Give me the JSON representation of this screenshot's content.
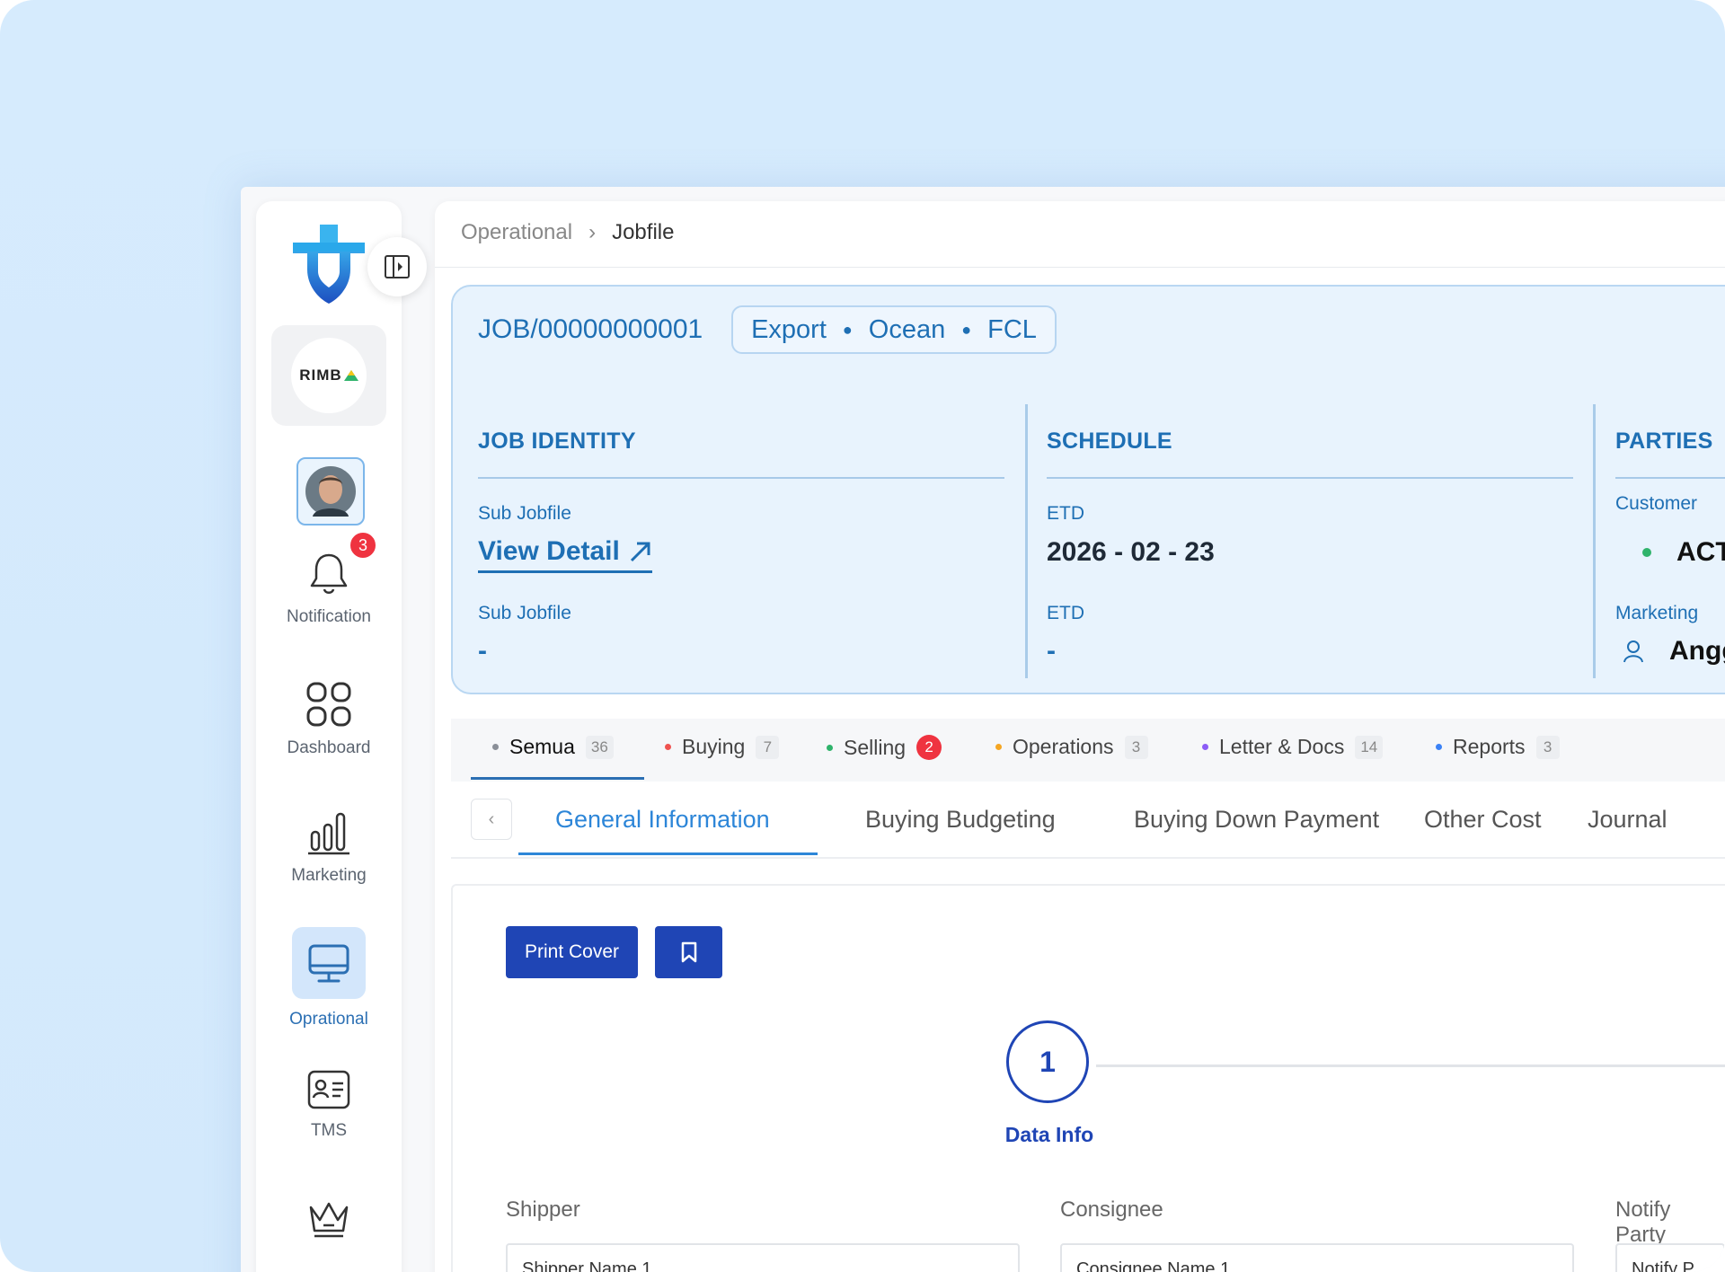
{
  "breadcrumb": {
    "parent": "Operational",
    "separator": "›",
    "current": "Jobfile"
  },
  "company": {
    "logo_text": "RIMB"
  },
  "sidebar": {
    "notification": {
      "label": "Notification",
      "badge": "3"
    },
    "items": [
      {
        "label": "Dashboard",
        "icon": "grid-icon"
      },
      {
        "label": "Marketing",
        "icon": "bar-chart-icon"
      },
      {
        "label": "Oprational",
        "icon": "monitor-icon",
        "active": true
      },
      {
        "label": "TMS",
        "icon": "id-card-icon"
      },
      {
        "label": "",
        "icon": "crown-icon"
      }
    ]
  },
  "job": {
    "id": "JOB/00000000001",
    "tags": [
      "Export",
      "Ocean",
      "FCL"
    ],
    "identity": {
      "title": "JOB IDENTITY",
      "sub1_label": "Sub Jobfile",
      "view_detail": "View Detail",
      "sub2_label": "Sub Jobfile",
      "sub2_value": "-"
    },
    "schedule": {
      "title": "SCHEDULE",
      "etd1_label": "ETD",
      "etd1_value": "2026 - 02 - 23",
      "etd2_label": "ETD",
      "etd2_value": "-"
    },
    "parties": {
      "title": "PARTIES",
      "customer_label": "Customer",
      "customer_value": "ACT",
      "marketing_label": "Marketing",
      "marketing_value": "Angg"
    }
  },
  "filter_tabs": [
    {
      "label": "Semua",
      "count": "36",
      "color": "#8a8f98",
      "active": true
    },
    {
      "label": "Buying",
      "count": "7",
      "color": "#ef5350"
    },
    {
      "label": "Selling",
      "count": "2",
      "color": "#2fb36b",
      "alert": true
    },
    {
      "label": "Operations",
      "count": "3",
      "color": "#f5a623"
    },
    {
      "label": "Letter & Docs",
      "count": "14",
      "color": "#8b5cf6"
    },
    {
      "label": "Reports",
      "count": "3",
      "color": "#3b82f6"
    }
  ],
  "sub_tabs": [
    "General Information",
    "Buying Budgeting",
    "Buying Down Payment",
    "Other Cost",
    "Journal"
  ],
  "actions": {
    "print_cover": "Print Cover"
  },
  "stepper": {
    "number": "1",
    "label": "Data Info"
  },
  "form": {
    "shipper_label": "Shipper",
    "shipper_value": "Shipper Name 1",
    "consignee_label": "Consignee",
    "consignee_value": "Consignee Name 1",
    "notify_label": "Notify Party",
    "notify_value": "Notify P"
  },
  "colors": {
    "primary": "#1e6fb4",
    "button": "#1f45b5",
    "accent": "#2d86d8"
  }
}
